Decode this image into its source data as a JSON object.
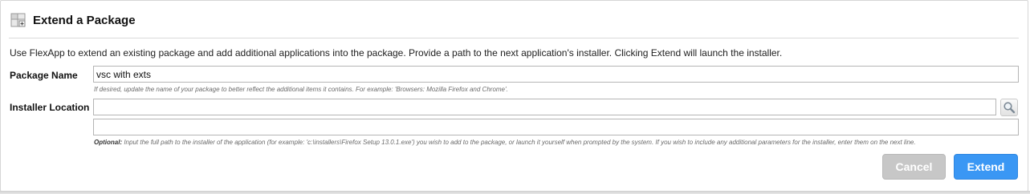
{
  "header": {
    "title": "Extend a Package",
    "icon": "package-extend-icon"
  },
  "description": "Use FlexApp to extend an existing package and add additional applications into the package. Provide a path to the next application's installer. Clicking Extend will launch the installer.",
  "package_name": {
    "label": "Package Name",
    "value": "vsc with exts",
    "hint": "If desired, update the name of your package to better reflect the additional items it contains. For example: 'Browsers: Mozilla Firefox and Chrome'."
  },
  "installer_location": {
    "label": "Installer Location",
    "value": "",
    "params_value": "",
    "browse_icon": "magnifier-icon",
    "hint_prefix": "Optional:",
    "hint": " Input the full path to the installer of the application (for example: 'c:\\installers\\Firefox Setup 13.0.1.exe') you wish to add to the package, or launch it yourself when prompted by the system. If you wish to include any additional parameters for the installer, enter them on the next line."
  },
  "buttons": {
    "cancel": "Cancel",
    "extend": "Extend"
  },
  "colors": {
    "extend_button": "#3a97f4",
    "cancel_button": "#c7c7c7"
  }
}
